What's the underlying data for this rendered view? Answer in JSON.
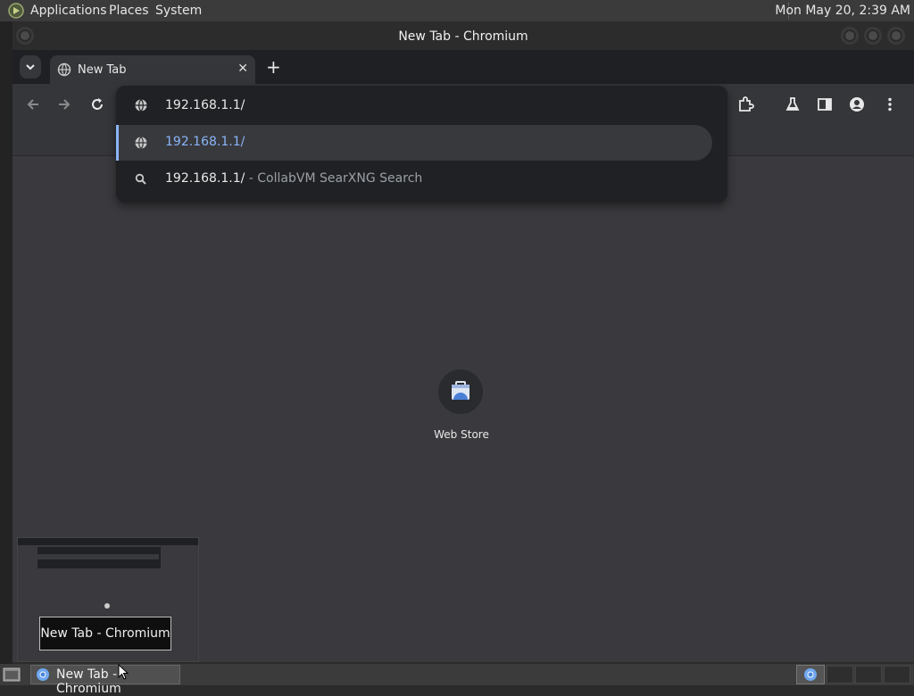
{
  "panel": {
    "menus": [
      "Applications",
      "Places",
      "System"
    ],
    "clock": "Mon May 20,  2:39 AM"
  },
  "window": {
    "title": "New Tab - Chromium"
  },
  "tabs": [
    {
      "label": "New Tab",
      "icon": "globe-icon"
    }
  ],
  "omnibox": {
    "input": "192.168.1.1/",
    "suggestions": [
      {
        "text": "192.168.1.1/",
        "description": "",
        "icon": "globe-icon",
        "selected": true
      },
      {
        "text": "192.168.1.1/",
        "description": " - CollabVM SearXNG Search",
        "icon": "search-icon",
        "selected": false
      }
    ]
  },
  "ntp": {
    "shortcuts": [
      {
        "label": "Web Store",
        "icon": "web-store-icon"
      }
    ]
  },
  "taskbar": {
    "tooltip": "New Tab - Chromium",
    "task_label": "New Tab - Chromium"
  },
  "colors": {
    "accent": "#8ab4f8",
    "background": "#3a3a3e",
    "dropdown": "#202124"
  }
}
